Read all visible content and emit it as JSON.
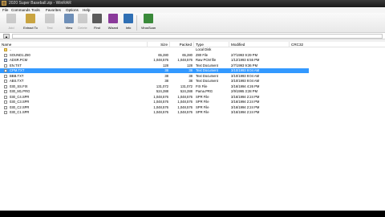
{
  "title": "2020 Super Baseball.zip - WinRAR",
  "menu": [
    "File",
    "Commands",
    "Tools",
    "Favorites",
    "Options",
    "Help"
  ],
  "toolbar": [
    {
      "label": "Add",
      "icon": "add-icon",
      "color": "#9a9a9a",
      "disabled": true
    },
    {
      "label": "Extract To",
      "icon": "extract-icon",
      "color": "#c9a441",
      "disabled": false
    },
    {
      "label": "Test",
      "icon": "test-icon",
      "color": "#9a9a9a",
      "disabled": true
    },
    {
      "label": "View",
      "icon": "view-icon",
      "color": "#6e8fb8",
      "disabled": false
    },
    {
      "label": "Delete",
      "icon": "delete-icon",
      "color": "#9a9a9a",
      "disabled": true
    },
    {
      "label": "Find",
      "icon": "find-icon",
      "color": "#5a5a5a",
      "disabled": false
    },
    {
      "label": "Wizard",
      "icon": "wizard-icon",
      "color": "#8a3a9a",
      "disabled": false
    },
    {
      "label": "Info",
      "icon": "info-icon",
      "color": "#2f6fb4",
      "disabled": false
    },
    {
      "label": "VirusScan",
      "icon": "virusscan-icon",
      "color": "#3a8a3a",
      "disabled": false
    }
  ],
  "columns": {
    "name": "Name",
    "size": "Size",
    "packed": "Packed",
    "type": "Type",
    "modified": "Modified",
    "crc": "CRC32"
  },
  "files": [
    {
      "name": "..",
      "size": "",
      "packed": "",
      "type": "Local Disk",
      "modified": "",
      "icon": "up"
    },
    {
      "name": "SOUND1.Z80",
      "size": "65,280",
      "packed": "65,280",
      "type": "Z80 File",
      "modified": "2/7/1993 9:29 PM",
      "icon": "file"
    },
    {
      "name": "ADSR.PCM",
      "size": "1,048,576",
      "packed": "1,048,576",
      "type": "Raw PCM file",
      "modified": "1/12/1993 6:55 PM",
      "icon": "pcm"
    },
    {
      "name": "EN.TXT",
      "size": "128",
      "packed": "128",
      "type": "Text Document",
      "modified": "2/7/1993 9:36 PM",
      "icon": "file"
    },
    {
      "name": "CPM.TXT",
      "size": "38",
      "packed": "38",
      "type": "Text Document",
      "modified": "3/10/1993 9:04 AM",
      "icon": "file",
      "selected": true
    },
    {
      "name": "BBB.TXT",
      "size": "38",
      "packed": "38",
      "type": "Text Document",
      "modified": "3/10/1993 9:04 AM",
      "icon": "file"
    },
    {
      "name": "ABS.TXT",
      "size": "38",
      "packed": "38",
      "type": "Text Document",
      "modified": "3/10/1993 9:04 AM",
      "icon": "file"
    },
    {
      "name": "030_SS.FIX",
      "size": "131,072",
      "packed": "131,072",
      "type": "FIX File",
      "modified": "3/16/1994 4:26 PM",
      "icon": "file"
    },
    {
      "name": "030_M1.PRG",
      "size": "524,288",
      "packed": "524,288",
      "type": "Pama.PRG",
      "modified": "2/9/1995 3:28 PM",
      "icon": "file"
    },
    {
      "name": "030_C4.SPR",
      "size": "1,048,576",
      "packed": "1,048,576",
      "type": "SPR File",
      "modified": "3/16/1994 2:24 PM",
      "icon": "file"
    },
    {
      "name": "030_C3.SPR",
      "size": "1,048,576",
      "packed": "1,048,576",
      "type": "SPR File",
      "modified": "3/16/1994 2:24 PM",
      "icon": "file"
    },
    {
      "name": "030_C2.SPR",
      "size": "1,048,576",
      "packed": "1,048,576",
      "type": "SPR File",
      "modified": "3/16/1994 2:24 PM",
      "icon": "file"
    },
    {
      "name": "030_C1.SPR",
      "size": "1,048,576",
      "packed": "1,048,576",
      "type": "SPR File",
      "modified": "3/16/1994 2:24 PM",
      "icon": "file"
    }
  ]
}
